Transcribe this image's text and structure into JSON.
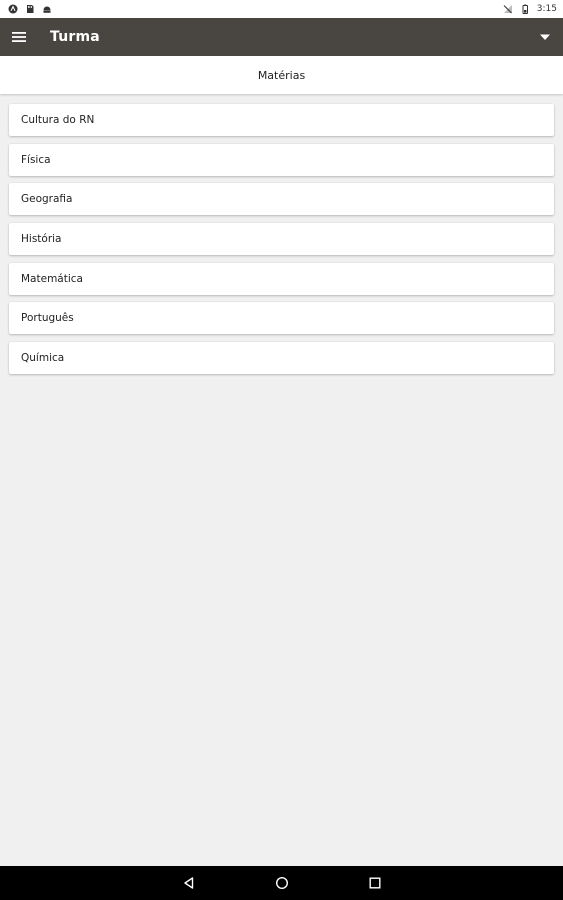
{
  "status_bar": {
    "time": "3:15",
    "left_icons": [
      "app-notification-icon",
      "sd-card-icon",
      "android-icon"
    ],
    "right_icons": [
      "no-signal-icon",
      "battery-icon"
    ]
  },
  "app_bar": {
    "title": "Turma",
    "background": "#494540"
  },
  "section": {
    "title": "Matérias"
  },
  "subjects": [
    {
      "label": "Cultura do RN"
    },
    {
      "label": "Física"
    },
    {
      "label": "Geografia"
    },
    {
      "label": "História"
    },
    {
      "label": "Matemática"
    },
    {
      "label": "Português"
    },
    {
      "label": "Química"
    }
  ],
  "nav_bar": {
    "buttons": [
      "back-icon",
      "home-icon",
      "recents-icon"
    ]
  }
}
